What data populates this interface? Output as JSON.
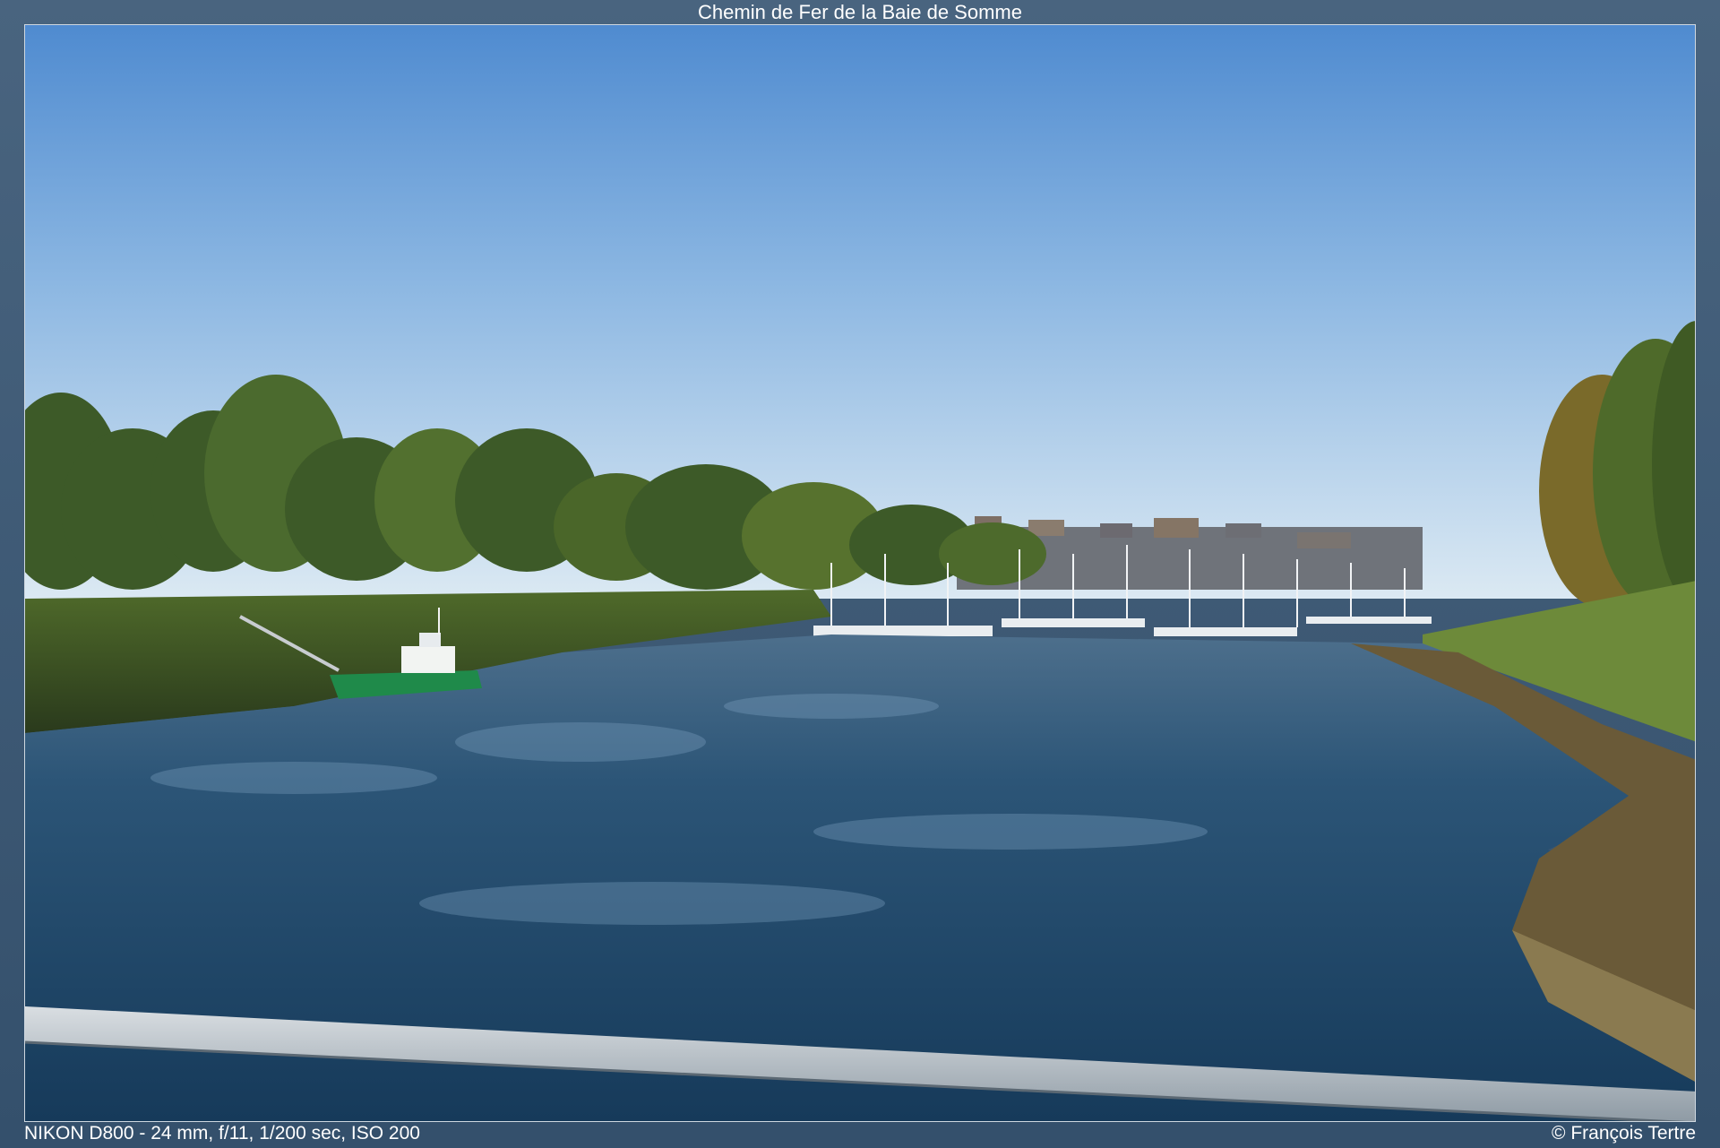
{
  "title": "Chemin de Fer de la Baie de Somme",
  "exif": "NIKON D800 - 24 mm, f/11, 1/200 sec, ISO 200",
  "copyright": "© François Tertre",
  "colors": {
    "frame": "#3f5a76",
    "sky_top": "#5d93d3",
    "sky_bottom": "#d6e6f3",
    "water": "#1c4466",
    "foliage": "#3c5a2a",
    "boat": "#1f8a4a"
  }
}
